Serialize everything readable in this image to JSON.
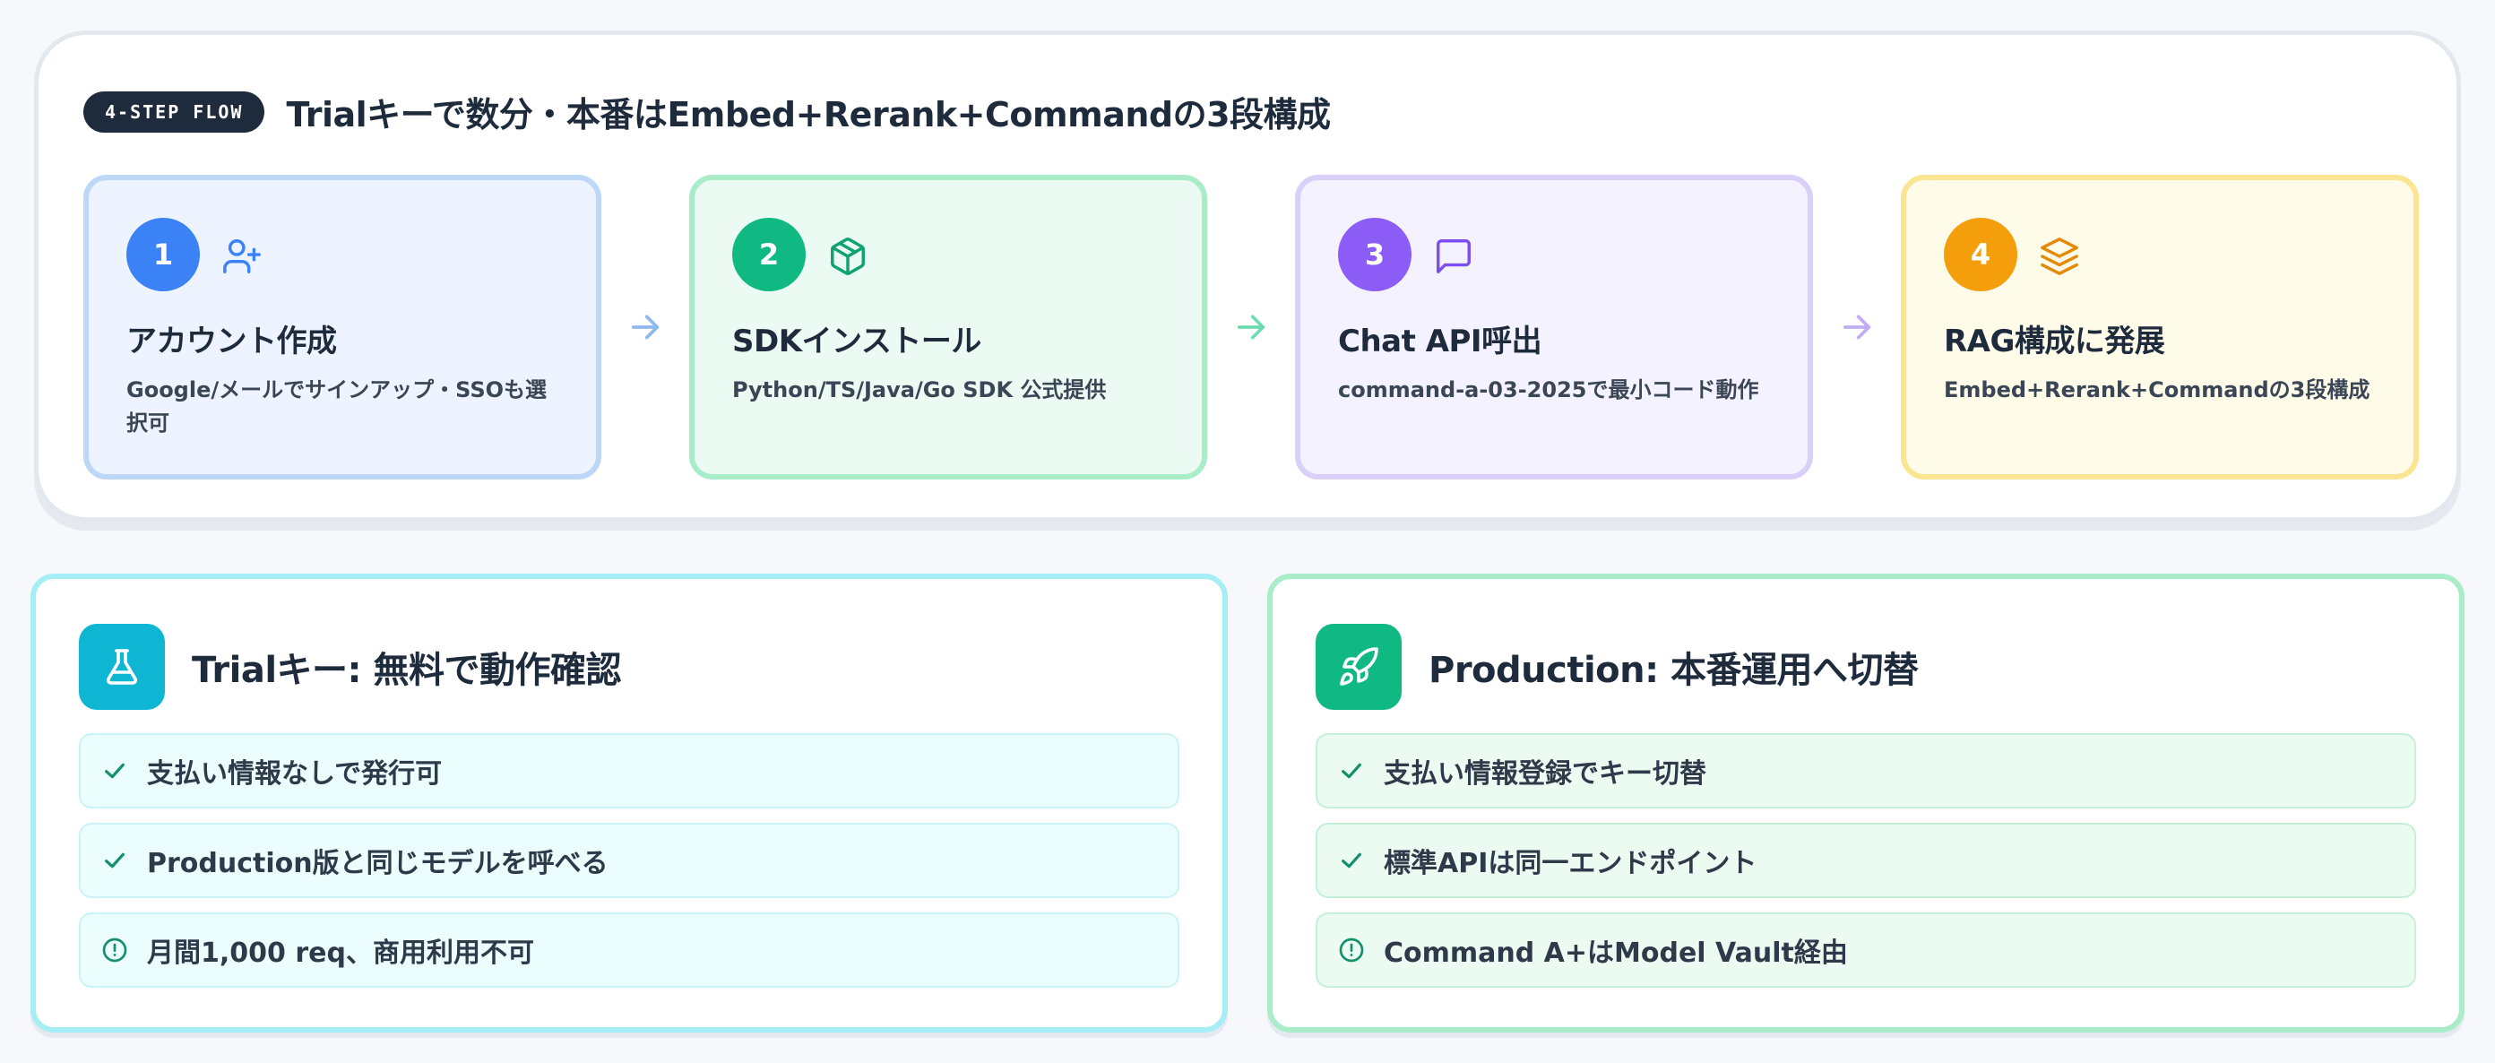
{
  "header": {
    "badge": "4-STEP FLOW",
    "title": "Trialキーで数分・本番はEmbed+Rerank+Commandの3段構成"
  },
  "steps": [
    {
      "number": "1",
      "icon": "user-plus-icon",
      "title": "アカウント作成",
      "desc": "Google/メールでサインアップ・SSOも選択可",
      "color": "#3b82f6",
      "bg": "#edf4ff",
      "border": "#bcd7f7"
    },
    {
      "number": "2",
      "icon": "package-icon",
      "title": "SDKインストール",
      "desc": "Python/TS/Java/Go SDK 公式提供",
      "color": "#10b981",
      "bg": "#ebfbf3",
      "border": "#a8ecc8"
    },
    {
      "number": "3",
      "icon": "message-square-icon",
      "title": "Chat API呼出",
      "desc": "command-a-03-2025で最小コード動作",
      "color": "#8b5cf6",
      "bg": "#f5f2ff",
      "border": "#d9cff8"
    },
    {
      "number": "4",
      "icon": "layers-icon",
      "title": "RAG構成に発展",
      "desc": "Embed+Rerank+Commandの3段構成",
      "color": "#f59e0b",
      "bg": "#fffbe9",
      "border": "#fbe592"
    }
  ],
  "trial": {
    "title": "Trialキー: 無料で動作確認",
    "icon": "flask-icon",
    "accent": "#0fb6d4",
    "items": [
      {
        "icon": "check-icon",
        "text": "支払い情報なしで発行可"
      },
      {
        "icon": "check-icon",
        "text": "Production版と同じモデルを呼べる"
      },
      {
        "icon": "alert-circle-icon",
        "text": "月間1,000 req、商用利用不可"
      }
    ]
  },
  "production": {
    "title": "Production: 本番運用へ切替",
    "icon": "rocket-icon",
    "accent": "#10b981",
    "items": [
      {
        "icon": "check-icon",
        "text": "支払い情報登録でキー切替"
      },
      {
        "icon": "check-icon",
        "text": "標準APIは同一エンドポイント"
      },
      {
        "icon": "alert-circle-icon",
        "text": "Command A+はModel Vault経由"
      }
    ]
  }
}
